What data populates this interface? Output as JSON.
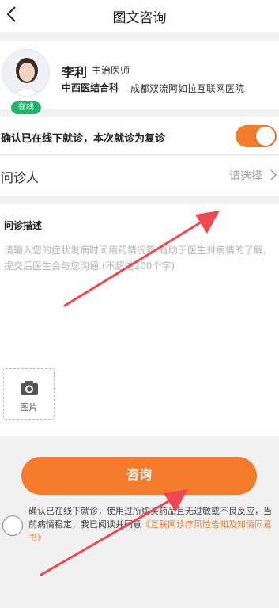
{
  "header": {
    "title": "图文咨询",
    "back_icon": "back-chevron-icon"
  },
  "doctor": {
    "name": "李利",
    "title": "主治医师",
    "department": "中西医结合科",
    "hospital": "成都双流阿如拉互联网医院",
    "status": "在线"
  },
  "confirm": {
    "text": "确认已在线下就诊，本次就诊为复诊",
    "toggle_on": true
  },
  "patient": {
    "label": "问诊人",
    "placeholder": "请选择"
  },
  "description": {
    "label": "问诊描述",
    "placeholder": "请输入您的症状发病时间用药情况等,有助于医生对病情的了解,提交后医生会与您沟通.(不超过200个字)"
  },
  "photo": {
    "label": "图片",
    "icon": "camera-icon"
  },
  "consult_button": {
    "label": "咨询"
  },
  "agreement": {
    "text": "确认已在线下就诊，使用过所购买药品且无过敏或不良反应，当前病情稳定，我已阅读并同意",
    "link": "《互联网诊疗风险告知及知情同意书》"
  },
  "colors": {
    "accent": "#f47a2c",
    "online": "#21b36b"
  }
}
